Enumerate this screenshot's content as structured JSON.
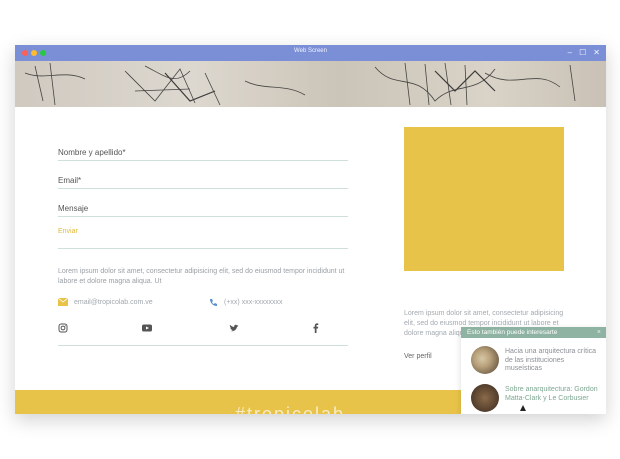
{
  "window": {
    "title": "Web Screen",
    "colors": {
      "titlebar": "#7b8fd6",
      "accent": "#e8c349",
      "popup_header": "#8fb3a2"
    }
  },
  "form": {
    "name_label": "Nombre y apellido*",
    "email_label": "Email*",
    "message_label": "Mensaje",
    "send_label": "Enviar",
    "description": "Lorem ipsum dolor sit amet, consectetur adipisicing elit, sed do eiusmod tempor incididunt ut labore et dolore magna aliqua. Ut",
    "email": "email@tropicolab.com.ve",
    "phone": "(+xx) xxx-xxxxxxxx"
  },
  "socials": [
    "instagram-icon",
    "youtube-icon",
    "twitter-icon",
    "facebook-icon"
  ],
  "sidebar": {
    "text": "Lorem ipsum dolor sit amet, consectetur adipisicing elit, sed do eiusmod tempor incididunt ut labore et dolore magna aliqua. Ut enim ad minim",
    "profile_link": "Ver perfil"
  },
  "popup": {
    "title": "Esto también puede interesarte",
    "close": "×",
    "items": [
      {
        "title": "Hacia una arquitectura crítica de las instituciones museísticas"
      },
      {
        "title": "Sobre anarquitectura: Gordon Matta-Clark y Le Corbusier"
      }
    ]
  },
  "band": {
    "text": "#tropicolab"
  }
}
